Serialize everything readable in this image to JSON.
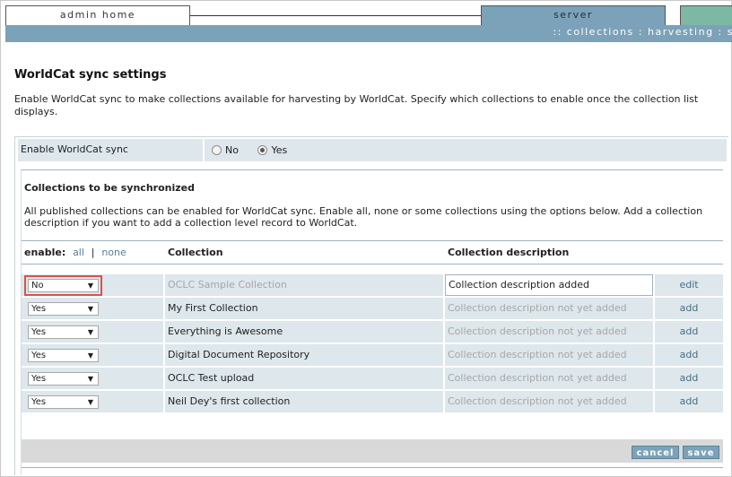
{
  "nav": {
    "admin_tab": "admin home",
    "server_tab": "server",
    "breadcrumb": ":: collections : harvesting : s"
  },
  "page": {
    "title": "WorldCat sync settings",
    "intro": "Enable WorldCat sync to make collections available for harvesting by WorldCat. Specify which collections to enable once the collection list displays."
  },
  "sync": {
    "label": "Enable WorldCat sync",
    "options": [
      "No",
      "Yes"
    ],
    "selected": "Yes"
  },
  "collections": {
    "title": "Collections to be synchronized",
    "description": "All published collections can be enabled for WorldCat sync. Enable all, none or some collections using the options below. Add a collection description if you want to add a collection level record to WorldCat.",
    "header": {
      "enable": "enable:",
      "all": "all",
      "separator": "|",
      "none": "none",
      "collection": "Collection",
      "description": "Collection description"
    },
    "rows": [
      {
        "enabled": "No",
        "name": "OCLC Sample Collection",
        "description": "Collection description added",
        "action": "edit"
      },
      {
        "enabled": "Yes",
        "name": "My First Collection",
        "description": "Collection description not yet added",
        "action": "add"
      },
      {
        "enabled": "Yes",
        "name": "Everything is Awesome",
        "description": "Collection description not yet added",
        "action": "add"
      },
      {
        "enabled": "Yes",
        "name": "Digital Document Repository",
        "description": "Collection description not yet added",
        "action": "add"
      },
      {
        "enabled": "Yes",
        "name": "OCLC Test upload",
        "description": "Collection description not yet added",
        "action": "add"
      },
      {
        "enabled": "Yes",
        "name": "Neil Dey's first collection",
        "description": "Collection description not yet added",
        "action": "add"
      }
    ]
  },
  "buttons": {
    "cancel": "cancel",
    "save": "save"
  },
  "colors": {
    "accent": "#7ba2b8",
    "row_bg": "#dde7ec",
    "highlight": "#d9534f"
  },
  "icons": {
    "dropdown": "triangle-down-icon",
    "radio": "radio-icon"
  }
}
